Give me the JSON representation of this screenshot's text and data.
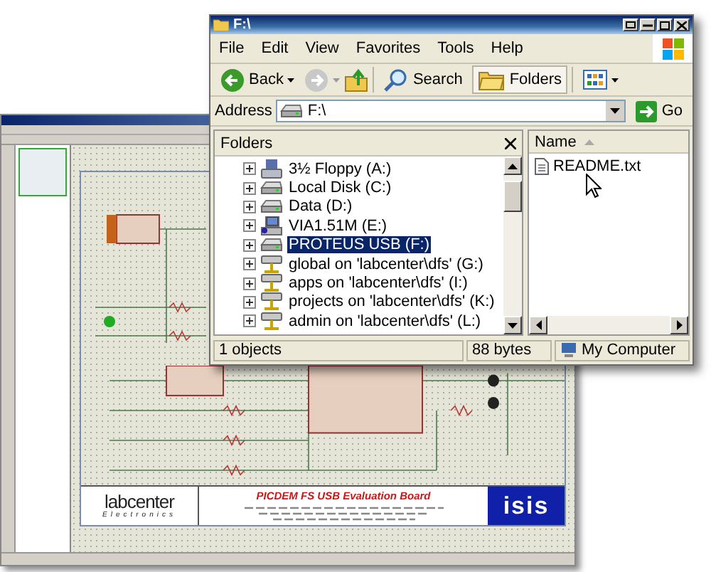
{
  "explorer": {
    "title": "F:\\",
    "menu": [
      "File",
      "Edit",
      "View",
      "Favorites",
      "Tools",
      "Help"
    ],
    "toolbar": {
      "back": "Back",
      "search": "Search",
      "folders": {
        "label": "Folders",
        "selected": true
      }
    },
    "address": {
      "label": "Address",
      "value": "F:\\",
      "go": "Go"
    },
    "folders_pane": {
      "title": "Folders",
      "items": [
        {
          "label": "3½ Floppy (A:)",
          "kind": "floppy",
          "selected": false
        },
        {
          "label": "Local Disk (C:)",
          "kind": "drive",
          "selected": false
        },
        {
          "label": "Data (D:)",
          "kind": "drive",
          "selected": false
        },
        {
          "label": "VIA1.51M (E:)",
          "kind": "cd",
          "selected": false
        },
        {
          "label": "PROTEUS USB (F:)",
          "kind": "drive",
          "selected": true
        },
        {
          "label": "global on 'labcenter\\dfs' (G:)",
          "kind": "network",
          "selected": false
        },
        {
          "label": "apps on 'labcenter\\dfs' (I:)",
          "kind": "network",
          "selected": false
        },
        {
          "label": "projects on 'labcenter\\dfs' (K:)",
          "kind": "network",
          "selected": false
        },
        {
          "label": "admin on 'labcenter\\dfs' (L:)",
          "kind": "network",
          "selected": false
        }
      ]
    },
    "files": {
      "column": "Name",
      "items": [
        {
          "name": "README.txt"
        }
      ]
    },
    "status_bar": [
      "1 objects",
      "88 bytes",
      "My Computer"
    ]
  },
  "isis": {
    "title_block": {
      "heading": "PICDEM FS USB Evaluation Board",
      "company": "labcenter",
      "company_sub": "Electronics",
      "logo": "isis"
    }
  }
}
